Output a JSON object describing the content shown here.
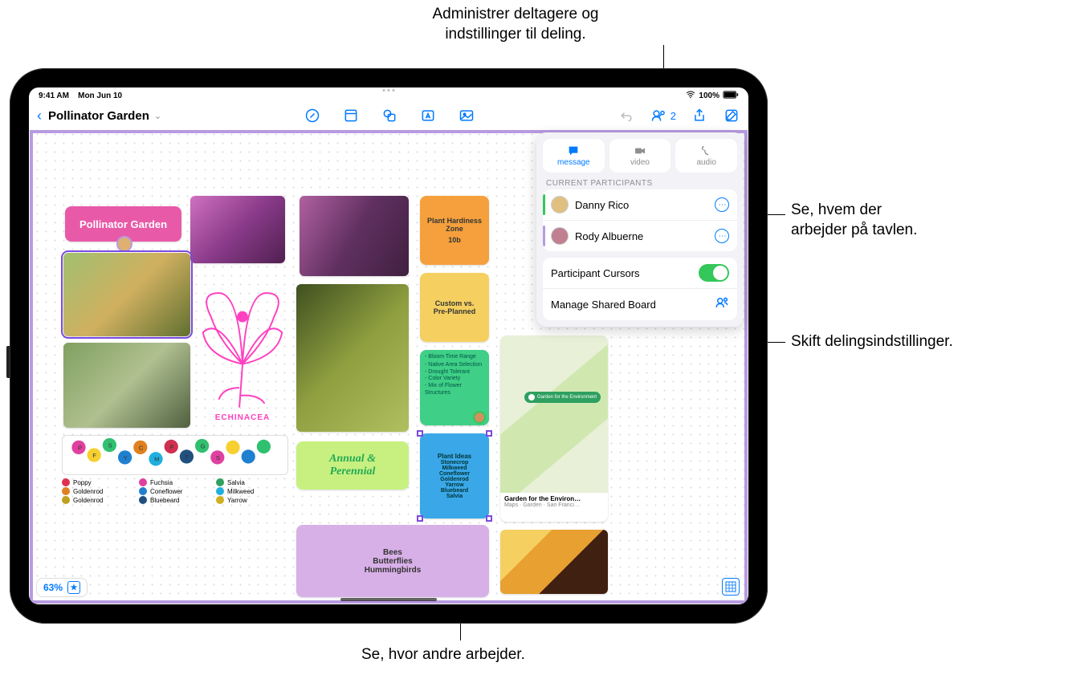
{
  "callouts": {
    "top": "Administrer deltagere og\nindstillinger til deling.",
    "right1": "Se, hvem der\narbejder på tavlen.",
    "right2": "Skift delingsindstillinger.",
    "bottom": "Se, hvor andre arbejder."
  },
  "statusbar": {
    "time": "9:41 AM",
    "date": "Mon Jun 10",
    "battery": "100%"
  },
  "board": {
    "title": "Pollinator Garden",
    "zoom": "63%",
    "collab_count": "2"
  },
  "popover": {
    "tabs": {
      "message": "message",
      "video": "video",
      "audio": "audio"
    },
    "section_label": "CURRENT PARTICIPANTS",
    "participants": [
      {
        "name": "Danny Rico",
        "edge": "#34c759"
      },
      {
        "name": "Rody Albuerne",
        "edge": "#b89be0"
      }
    ],
    "cursors_label": "Participant Cursors",
    "manage_label": "Manage Shared Board"
  },
  "cards": {
    "title_card": "Pollinator Garden",
    "zone": {
      "label": "Plant Hardiness\nZone",
      "value": "10b"
    },
    "custom": "Custom vs.\nPre-Planned",
    "bloom": [
      "Bloom Time Range",
      "Native Area Selection",
      "Drought Tolerant",
      "Color Variety",
      "Mix of Flower Structures"
    ],
    "ideas_title": "Plant Ideas",
    "ideas": [
      "Stonecrop",
      "Milkweed",
      "Coneflower",
      "Goldenrod",
      "Yarrow",
      "Bluebeard",
      "Salvia"
    ],
    "echinacea": "ECHINACEA",
    "annual": "Annual &\nPerennial",
    "bees": "Bees\nButterflies\nHummingbirds",
    "map_title": "Garden for the Environ…",
    "map_sub": "Maps · Garden · San Franci…",
    "map_pin": "Garden for the Environment"
  },
  "legend": {
    "rows": [
      {
        "c": "#e03050",
        "n": "Poppy"
      },
      {
        "c": "#e040a0",
        "n": "Fuchsia"
      },
      {
        "c": "#2ea060",
        "n": "Salvia"
      },
      {
        "c": "#e08020",
        "n": "Goldenrod"
      },
      {
        "c": "#2080d0",
        "n": "Coneflower"
      },
      {
        "c": "#20b0e0",
        "n": "Milkweed"
      },
      {
        "c": "#c0a020",
        "n": "Goldenrod"
      },
      {
        "c": "#205080",
        "n": "Bluebeard"
      },
      {
        "c": "#d0b020",
        "n": "Yarrow"
      }
    ]
  }
}
